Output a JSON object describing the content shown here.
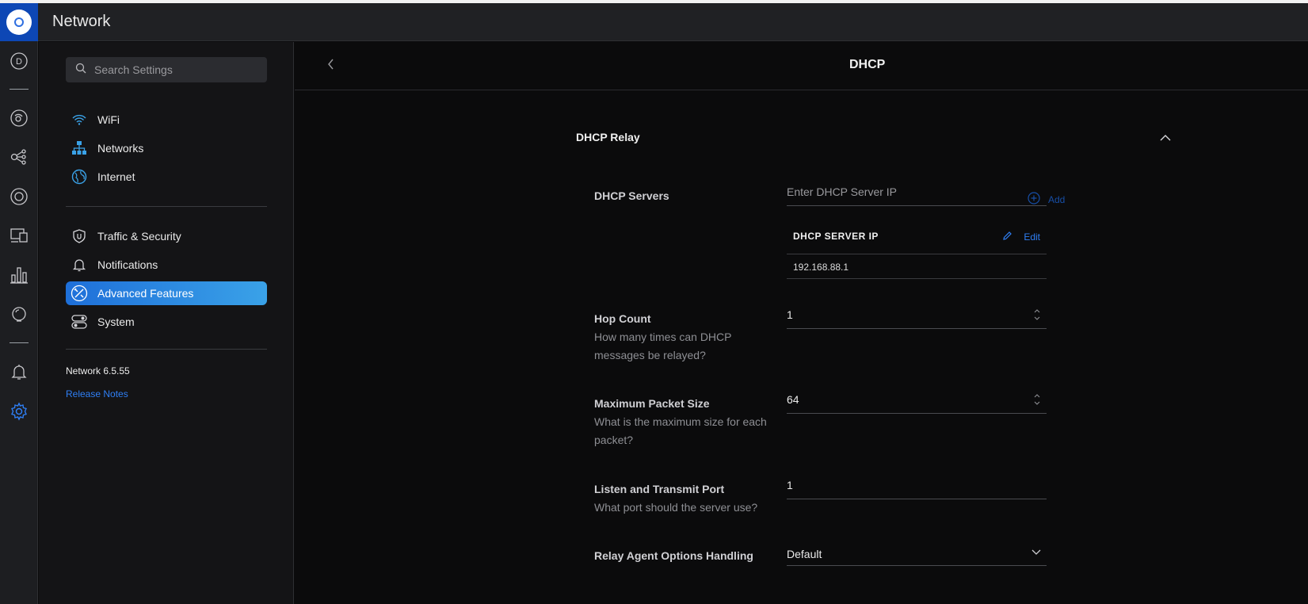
{
  "app": {
    "title": "Network",
    "accent_color": "#1e6fd9",
    "logo_icon": "ubiquiti-logo-icon"
  },
  "rail": {
    "avatar_letter": "D",
    "icons": [
      "dashboard-avatar-icon",
      "topology-icon",
      "devices-icon",
      "clients-icon",
      "statistics-icon",
      "insights-icon",
      "alerts-bell-icon",
      "settings-gear-icon"
    ]
  },
  "settings_nav": {
    "search_placeholder": "Search Settings",
    "items": [
      {
        "label": "WiFi",
        "icon": "wifi-icon"
      },
      {
        "label": "Networks",
        "icon": "networks-icon"
      },
      {
        "label": "Internet",
        "icon": "globe-icon"
      },
      {
        "label": "Traffic & Security",
        "icon": "shield-icon"
      },
      {
        "label": "Notifications",
        "icon": "bell-icon"
      },
      {
        "label": "Advanced Features",
        "icon": "advanced-tools-icon",
        "active": true
      },
      {
        "label": "System",
        "icon": "system-toggle-icon"
      }
    ],
    "version": "Network 6.5.55",
    "release_notes": "Release Notes"
  },
  "main": {
    "page_title": "DHCP",
    "section": {
      "title": "DHCP Relay",
      "dhcp_servers": {
        "label": "DHCP Servers",
        "placeholder": "Enter DHCP Server IP",
        "add_label": "Add",
        "table": {
          "header": "DHCP SERVER IP",
          "edit_label": "Edit",
          "rows": [
            "192.168.88.1"
          ]
        }
      },
      "hop_count": {
        "label": "Hop Count",
        "description": "How many times can DHCP messages be relayed?",
        "value": "1"
      },
      "max_packet_size": {
        "label": "Maximum Packet Size",
        "description": "What is the maximum size for each packet?",
        "value": "64"
      },
      "listen_port": {
        "label": "Listen and Transmit Port",
        "description": "What port should the server use?",
        "value": "1"
      },
      "relay_agent": {
        "label": "Relay Agent Options Handling",
        "value": "Default"
      }
    }
  }
}
